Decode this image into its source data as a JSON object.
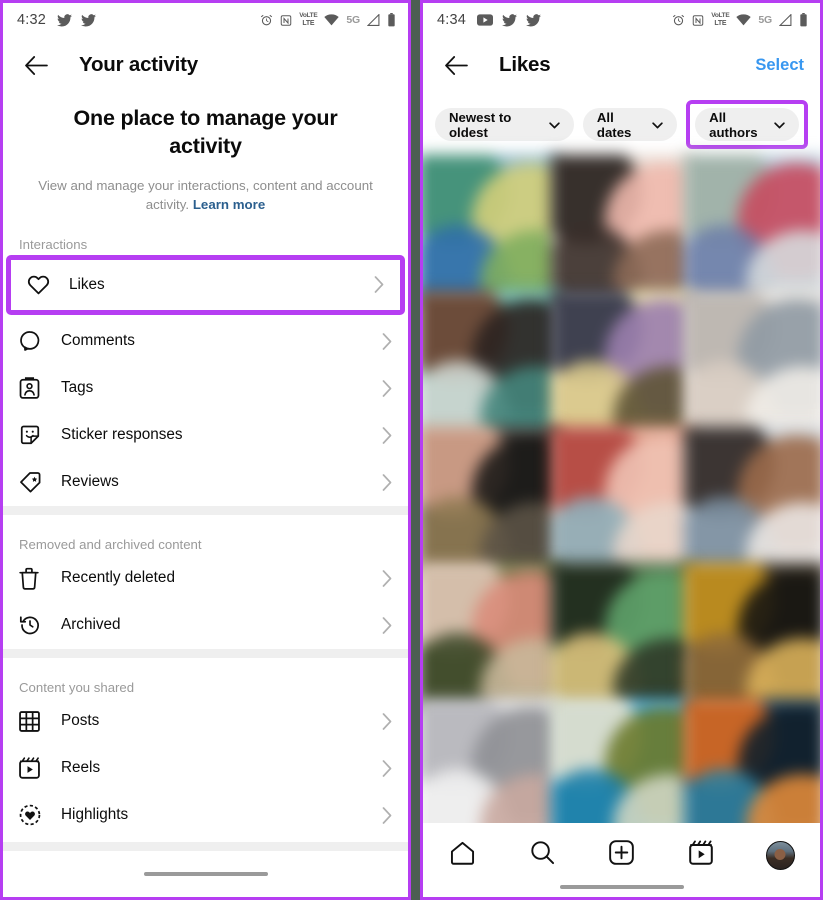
{
  "left_phone": {
    "status_bar": {
      "time": "4:32",
      "left_icons": [
        "twitter-icon",
        "twitter-icon"
      ],
      "right_icons": [
        "alarm-icon",
        "nfc-icon",
        "volte-lte-icon",
        "wifi-icon",
        "5g-label",
        "signal-icon",
        "battery-icon"
      ],
      "volte_top": "VoLTE",
      "volte_bottom": "LTE",
      "network_label": "5G"
    },
    "appbar": {
      "title": "Your activity",
      "back_icon": "arrow-left-icon"
    },
    "hero": {
      "heading": "One place to manage your activity",
      "description": "View and manage your interactions, content and account activity. ",
      "link": "Learn more"
    },
    "sections": [
      {
        "label": "Interactions",
        "items": [
          {
            "label": "Likes",
            "icon": "heart-icon",
            "highlighted": true
          },
          {
            "label": "Comments",
            "icon": "comment-icon",
            "highlighted": false
          },
          {
            "label": "Tags",
            "icon": "tag-person-icon",
            "highlighted": false
          },
          {
            "label": "Sticker responses",
            "icon": "sticker-icon",
            "highlighted": false
          },
          {
            "label": "Reviews",
            "icon": "review-tag-icon",
            "highlighted": false
          }
        ]
      },
      {
        "label": "Removed and archived content",
        "items": [
          {
            "label": "Recently deleted",
            "icon": "trash-icon",
            "highlighted": false
          },
          {
            "label": "Archived",
            "icon": "history-clock-icon",
            "highlighted": false
          }
        ]
      },
      {
        "label": "Content you shared",
        "items": [
          {
            "label": "Posts",
            "icon": "grid-icon",
            "highlighted": false
          },
          {
            "label": "Reels",
            "icon": "reels-icon",
            "highlighted": false
          },
          {
            "label": "Highlights",
            "icon": "highlights-heart-icon",
            "highlighted": false
          }
        ]
      }
    ]
  },
  "right_phone": {
    "status_bar": {
      "time": "4:34",
      "left_icons": [
        "youtube-icon",
        "twitter-icon",
        "twitter-icon"
      ],
      "right_icons": [
        "alarm-icon",
        "nfc-icon",
        "volte-lte-icon",
        "wifi-icon",
        "5g-label",
        "signal-icon",
        "battery-icon"
      ],
      "volte_top": "VoLTE",
      "volte_bottom": "LTE",
      "network_label": "5G"
    },
    "appbar": {
      "title": "Likes",
      "back_icon": "arrow-left-icon",
      "action": "Select"
    },
    "filters": [
      {
        "label": "Newest to oldest",
        "icon": "chevron-down-icon",
        "highlighted": false
      },
      {
        "label": "All dates",
        "icon": "chevron-down-icon",
        "highlighted": false
      },
      {
        "label": "All authors",
        "icon": "chevron-down-icon",
        "highlighted": true
      }
    ],
    "grid": {
      "columns": 3,
      "cells": [
        {
          "bg": "#8fb9c9",
          "blobs": [
            "#3e8f72",
            "#d3cf7a",
            "#2f6fa8",
            "#7fae5e"
          ]
        },
        {
          "bg": "#e8dcd4",
          "blobs": [
            "#241d1a",
            "#f0b9ad",
            "#3a2f2a",
            "#8d6a58"
          ]
        },
        {
          "bg": "#b9cede",
          "blobs": [
            "#9fb0a4",
            "#c74a5e",
            "#6e7fa8",
            "#d5d9dc"
          ]
        },
        {
          "bg": "#6fbdb2",
          "blobs": [
            "#6b3f2c",
            "#2b2220",
            "#cfd6d0",
            "#44857c"
          ]
        },
        {
          "bg": "#e3d8a8",
          "blobs": [
            "#2c3146",
            "#9b7fae",
            "#d9c98c",
            "#5e5436"
          ]
        },
        {
          "bg": "#e6e2dd",
          "blobs": [
            "#b9b4ad",
            "#8f9aa3",
            "#d8cdc2",
            "#f0ece7"
          ]
        },
        {
          "bg": "#3a3632",
          "blobs": [
            "#d8a48c",
            "#1b1917",
            "#8f7a52",
            "#5c5346"
          ]
        },
        {
          "bg": "#dd9a84",
          "blobs": [
            "#b2463f",
            "#f0c3b4",
            "#8fb0bb",
            "#e8d6cb"
          ]
        },
        {
          "bg": "#cfd6dc",
          "blobs": [
            "#2b2420",
            "#9b6a4a",
            "#7b8fa0",
            "#eae6e2"
          ]
        },
        {
          "bg": "#6b6f3f",
          "blobs": [
            "#e0c7b6",
            "#d98c7a",
            "#3f4a2b",
            "#c9b89a"
          ]
        },
        {
          "bg": "#4c6b45",
          "blobs": [
            "#1f2a1c",
            "#5fa36a",
            "#d9c07a",
            "#2f3a28"
          ]
        },
        {
          "bg": "#3a3226",
          "blobs": [
            "#c8941f",
            "#171512",
            "#8f6a3a",
            "#d9b05a"
          ]
        },
        {
          "bg": "#dcdcde",
          "blobs": [
            "#b6b6bb",
            "#8f9095",
            "#efefef",
            "#c9a9a0"
          ]
        },
        {
          "bg": "#3f9fc9",
          "blobs": [
            "#e6e2cf",
            "#6b7a2c",
            "#1d7fa8",
            "#cfd6c2"
          ]
        },
        {
          "bg": "#1f3a4c",
          "blobs": [
            "#d96a22",
            "#0f1f2b",
            "#2f7f9f",
            "#e08a3a"
          ]
        }
      ]
    },
    "bottom_nav": [
      {
        "icon": "home-icon",
        "label": "Home"
      },
      {
        "icon": "search-icon",
        "label": "Search"
      },
      {
        "icon": "create-plus-icon",
        "label": "Create"
      },
      {
        "icon": "reels-icon",
        "label": "Reels"
      },
      {
        "icon": "profile-avatar",
        "label": "Profile"
      }
    ]
  },
  "theme": {
    "highlight_purple": "#b63ef2",
    "link_blue": "#3897f0",
    "muted_gray": "#8e8e8e",
    "chip_bg": "#efefef",
    "separator": "#efefef"
  }
}
